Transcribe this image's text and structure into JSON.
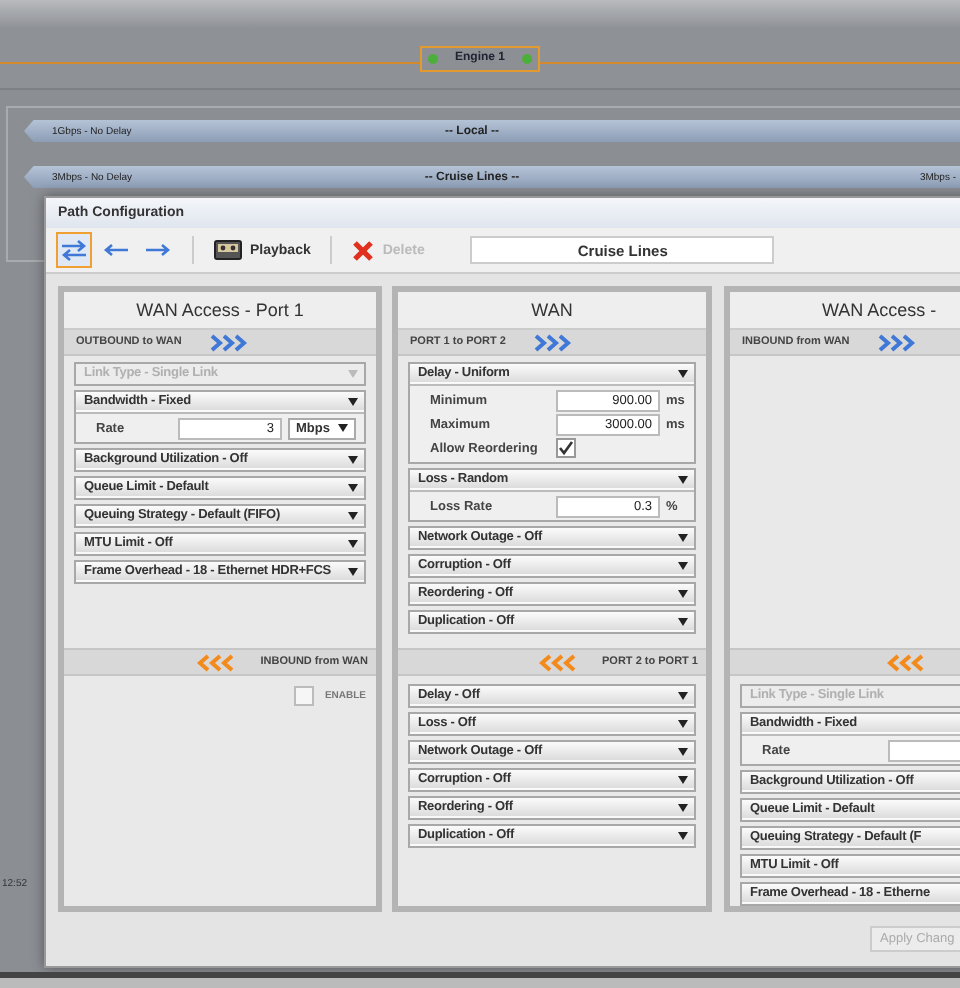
{
  "engine": {
    "label": "Engine 1"
  },
  "links": [
    {
      "rate": "1Gbps - No Delay",
      "name": "-- Local --"
    },
    {
      "rate": "3Mbps - No Delay",
      "name": "-- Cruise Lines --",
      "rate_right": "3Mbps -"
    }
  ],
  "clock": "12:52",
  "dialog": {
    "title": "Path Configuration",
    "toolbar": [
      {
        "kind": "swap",
        "selected": true
      },
      {
        "kind": "back",
        "selected": false
      },
      {
        "kind": "forward",
        "selected": false
      },
      {
        "kind": "playback",
        "label": "Playback",
        "disabled": false
      },
      {
        "kind": "delete",
        "label": "Delete",
        "disabled": true
      }
    ],
    "path_name": "Cruise Lines",
    "panels": [
      {
        "title": "WAN Access - Port 1",
        "top": {
          "label": "OUTBOUND to WAN"
        },
        "top_sections": [
          {
            "title": "Link Type - Single Link",
            "disabled": true
          },
          {
            "title": "Bandwidth - Fixed",
            "disabled": false,
            "fields": [
              {
                "kind": "number",
                "label": "Rate",
                "value": "3",
                "unit": "Mbps",
                "unit_dropdown": true
              }
            ]
          },
          {
            "title": "Background Utilization - Off",
            "disabled": false
          },
          {
            "title": "Queue Limit - Default",
            "disabled": false
          },
          {
            "title": "Queuing Strategy - Default (FIFO)",
            "disabled": false
          },
          {
            "title": "MTU Limit - Off",
            "disabled": false
          },
          {
            "title": "Frame Overhead - 18 - Ethernet HDR+FCS",
            "disabled": false
          }
        ],
        "bottom": {
          "label": "INBOUND from WAN"
        },
        "enable": {
          "label": "ENABLE",
          "checked": false
        }
      },
      {
        "title": "WAN",
        "top": {
          "label": "PORT 1 to PORT 2"
        },
        "top_sections": [
          {
            "title": "Delay - Uniform",
            "disabled": false,
            "fields": [
              {
                "kind": "number",
                "label": "Minimum",
                "value": "900.00",
                "unit": "ms",
                "unit_dropdown": false
              },
              {
                "kind": "number",
                "label": "Maximum",
                "value": "3000.00",
                "unit": "ms",
                "unit_dropdown": false
              },
              {
                "kind": "checkbox",
                "label": "Allow Reordering",
                "checked": true
              }
            ]
          },
          {
            "title": "Loss - Random",
            "disabled": false,
            "fields": [
              {
                "kind": "number",
                "label": "Loss Rate",
                "value": "0.3",
                "unit": "%",
                "unit_dropdown": false
              }
            ]
          },
          {
            "title": "Network Outage - Off",
            "disabled": false
          },
          {
            "title": "Corruption - Off",
            "disabled": false
          },
          {
            "title": "Reordering - Off",
            "disabled": false
          },
          {
            "title": "Duplication - Off",
            "disabled": false
          }
        ],
        "bottom": {
          "label": "PORT 2 to PORT 1"
        },
        "bottom_sections": [
          {
            "title": "Delay - Off",
            "disabled": false
          },
          {
            "title": "Loss - Off",
            "disabled": false
          },
          {
            "title": "Network Outage - Off",
            "disabled": false
          },
          {
            "title": "Corruption - Off",
            "disabled": false
          },
          {
            "title": "Reordering - Off",
            "disabled": false
          },
          {
            "title": "Duplication - Off",
            "disabled": false
          }
        ]
      },
      {
        "title": "WAN Access -",
        "top": {
          "label": "INBOUND from WAN"
        },
        "bottom_sections": [
          {
            "title": "Link Type - Single Link",
            "disabled": true
          },
          {
            "title": "Bandwidth - Fixed",
            "disabled": false,
            "fields": [
              {
                "kind": "number",
                "label": "Rate"
              }
            ]
          },
          {
            "title": "Background Utilization - Off",
            "disabled": false
          },
          {
            "title": "Queue Limit - Default",
            "disabled": false
          },
          {
            "title": "Queuing Strategy - Default (F",
            "disabled": false
          },
          {
            "title": "MTU Limit - Off",
            "disabled": false
          },
          {
            "title": "Frame Overhead - 18 - Etherne",
            "disabled": false
          }
        ]
      }
    ],
    "apply": {
      "label": "Apply Chang",
      "disabled": true
    }
  }
}
